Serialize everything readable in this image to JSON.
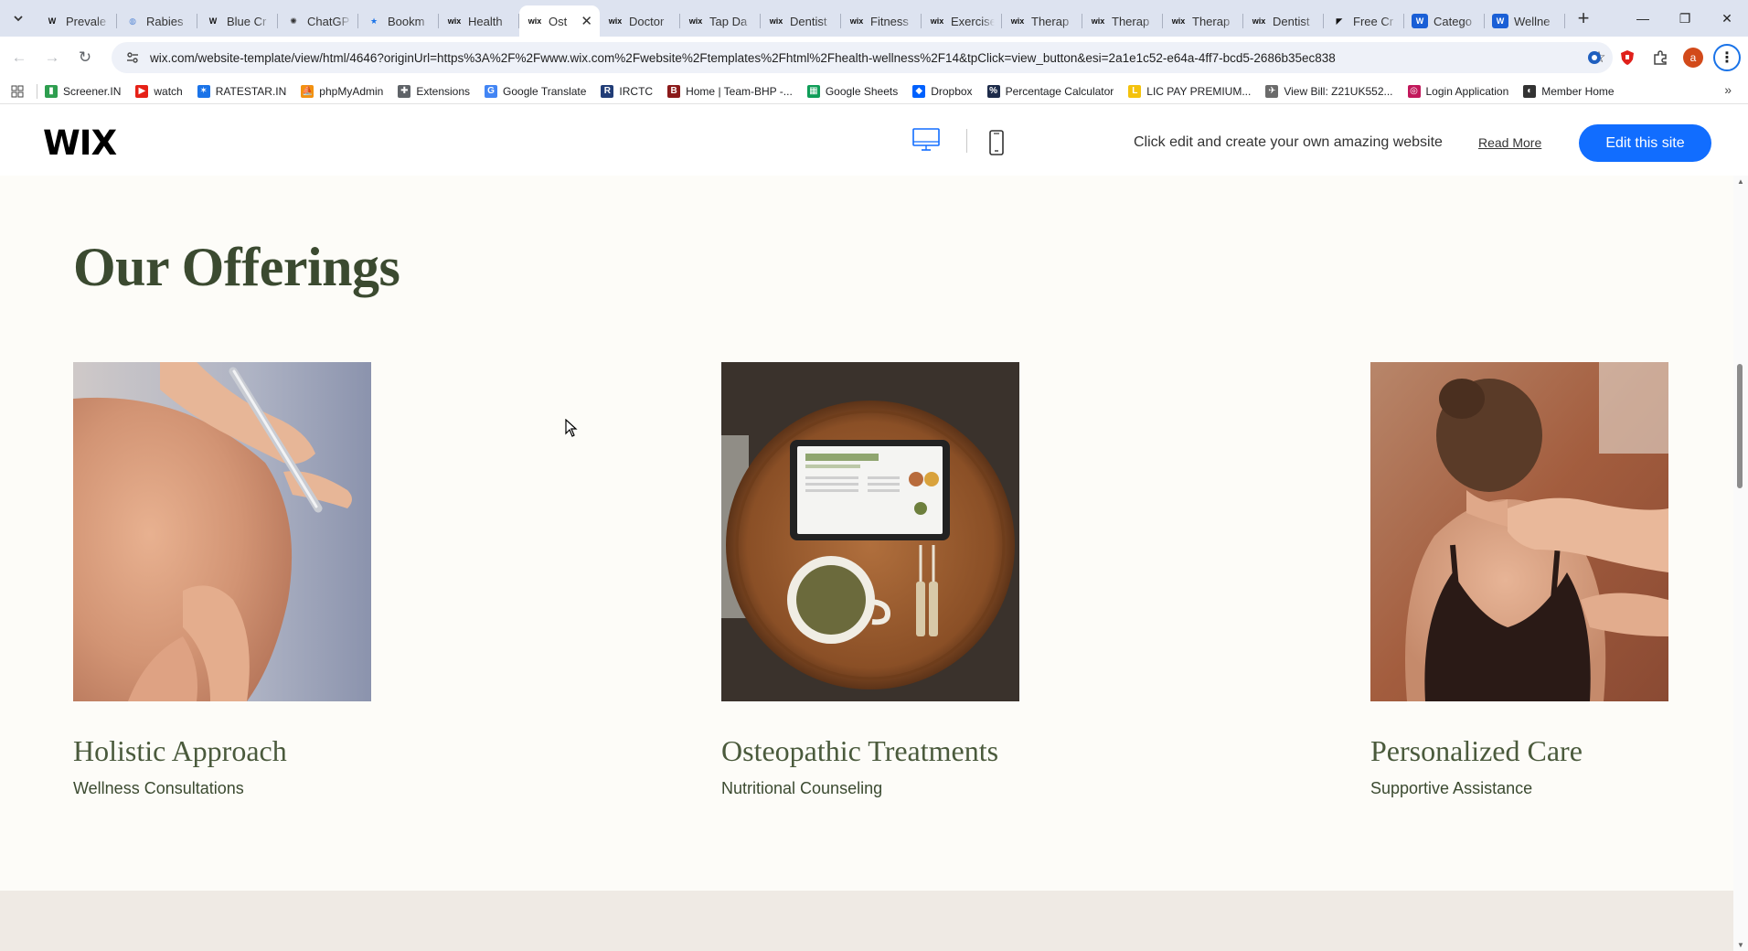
{
  "browser": {
    "tabs": [
      {
        "label": "Prevale",
        "icon": "wikipedia-icon"
      },
      {
        "label": "Rabies",
        "icon": "globe-icon"
      },
      {
        "label": "Blue Cr",
        "icon": "wikipedia-icon"
      },
      {
        "label": "ChatGP",
        "icon": "chatgpt-icon"
      },
      {
        "label": "Bookm",
        "icon": "bookmark-icon"
      },
      {
        "label": "Health",
        "icon": "wix-icon"
      },
      {
        "label": "Ost",
        "icon": "wix-icon",
        "active": true
      },
      {
        "label": "Doctor",
        "icon": "wix-icon"
      },
      {
        "label": "Tap Da",
        "icon": "wix-icon"
      },
      {
        "label": "Dentist",
        "icon": "wix-icon"
      },
      {
        "label": "Fitness",
        "icon": "wix-icon"
      },
      {
        "label": "Exercise",
        "icon": "wix-icon"
      },
      {
        "label": "Therap",
        "icon": "wix-icon"
      },
      {
        "label": "Therap",
        "icon": "wix-icon"
      },
      {
        "label": "Therap",
        "icon": "wix-icon"
      },
      {
        "label": "Dentist",
        "icon": "wix-icon"
      },
      {
        "label": "Free Cr",
        "icon": "framer-icon"
      },
      {
        "label": "Catego",
        "icon": "wix-blue-icon"
      },
      {
        "label": "Wellne",
        "icon": "wix-blue-icon"
      }
    ],
    "url": "wix.com/website-template/view/html/4646?originUrl=https%3A%2F%2Fwww.wix.com%2Fwebsite%2Ftemplates%2Fhtml%2Fhealth-wellness%2F14&tpClick=view_button&esi=2a1e1c52-e64a-4ff7-bcd5-2686b35ec838",
    "profile_initial": "a",
    "bookmarks": [
      {
        "label": "Screener.IN",
        "color": "#2e9e4f",
        "glyph": "▮"
      },
      {
        "label": "watch",
        "color": "#e62117",
        "glyph": "▶"
      },
      {
        "label": "RATESTAR.IN",
        "color": "#1a73e8",
        "glyph": "✶"
      },
      {
        "label": "phpMyAdmin",
        "color": "#f29111",
        "glyph": "⛵"
      },
      {
        "label": "Extensions",
        "color": "#5f6368",
        "glyph": "✚"
      },
      {
        "label": "Google Translate",
        "color": "#4285f4",
        "glyph": "G"
      },
      {
        "label": "IRCTC",
        "color": "#213d77",
        "glyph": "R"
      },
      {
        "label": "Home | Team-BHP -...",
        "color": "#8b1a1a",
        "glyph": "B"
      },
      {
        "label": "Google Sheets",
        "color": "#0f9d58",
        "glyph": "▦"
      },
      {
        "label": "Dropbox",
        "color": "#0061fe",
        "glyph": "◆"
      },
      {
        "label": "Percentage Calculator",
        "color": "#1d2b4a",
        "glyph": "%"
      },
      {
        "label": "LIC PAY PREMIUM...",
        "color": "#f4c20d",
        "glyph": "L"
      },
      {
        "label": "View Bill: Z21UK552...",
        "color": "#6b6b6b",
        "glyph": "✈"
      },
      {
        "label": "Login Application",
        "color": "#c2185b",
        "glyph": "◎"
      },
      {
        "label": "Member Home",
        "color": "#333333",
        "glyph": "◐"
      }
    ]
  },
  "wix_bar": {
    "logo": "WIX",
    "promo_text": "Click edit and create your own amazing website",
    "read_more": "Read More",
    "edit_button": "Edit this site",
    "accent": "#116dff"
  },
  "page": {
    "title": "Our Offerings",
    "cards": [
      {
        "title": "Holistic Approach",
        "subtitle": "Wellness Consultations"
      },
      {
        "title": "Osteopathic Treatments",
        "subtitle": "Nutritional Counseling"
      },
      {
        "title": "Personalized Care",
        "subtitle": "Supportive Assistance"
      }
    ],
    "colors": {
      "heading": "#3b4a30",
      "background": "#fdfcf8",
      "band": "#efeae4"
    }
  }
}
